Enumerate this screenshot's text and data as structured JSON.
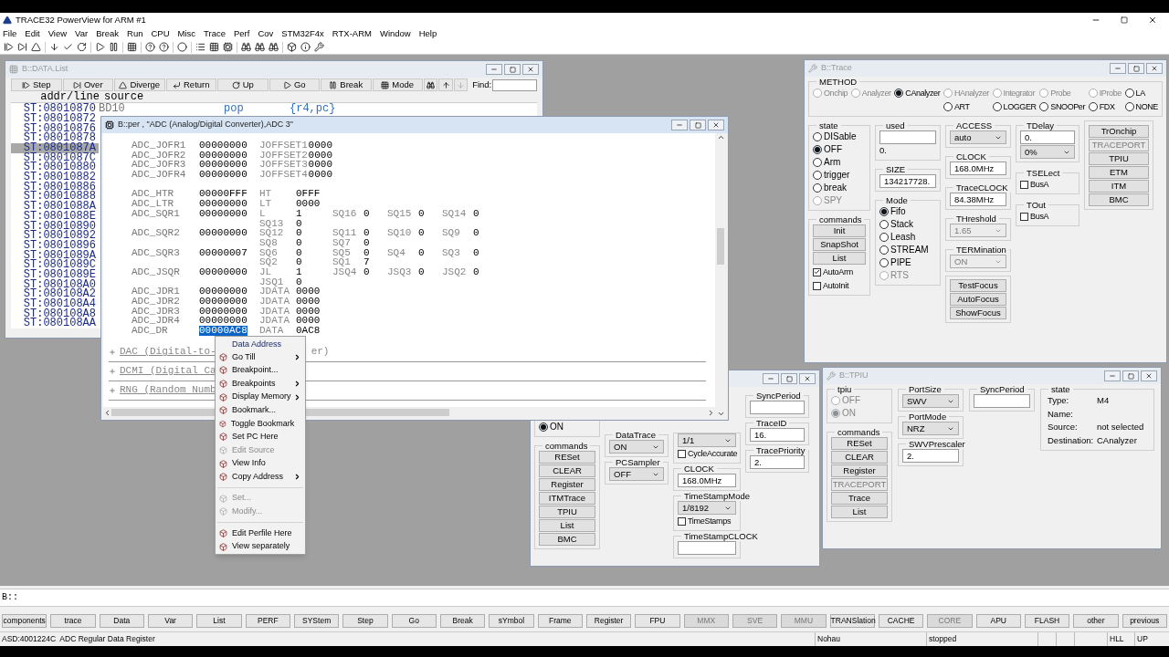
{
  "window": {
    "title": "TRACE32 PowerView for ARM #1"
  },
  "menu": [
    "File",
    "Edit",
    "View",
    "Var",
    "Break",
    "Run",
    "CPU",
    "Misc",
    "Trace",
    "Perf",
    "Cov",
    "STM32F4x",
    "RTX-ARM",
    "Window",
    "Help"
  ],
  "data_list": {
    "title": "B::DATA.List",
    "active": false,
    "buttons": [
      "Step",
      "Over",
      "Diverge",
      "Return",
      "Up",
      "Go",
      "Break",
      "Mode"
    ],
    "find_label": "Find:",
    "columns": [
      "addr/line",
      "source"
    ],
    "first_source": {
      "label": "BD10",
      "mnemonic": "pop",
      "operands": "{r4,pc}"
    },
    "rows": [
      {
        "address": "ST:08010870",
        "selected": false
      },
      {
        "address": "ST:08010872",
        "selected": false
      },
      {
        "address": "ST:08010876",
        "selected": false
      },
      {
        "address": "ST:08010878",
        "selected": false
      },
      {
        "address": "ST:0801087A",
        "selected": true
      },
      {
        "address": "ST:0801087C",
        "selected": false
      },
      {
        "address": "ST:08010880",
        "selected": false
      },
      {
        "address": "ST:08010882",
        "selected": false
      },
      {
        "address": "ST:08010886",
        "selected": false
      },
      {
        "address": "ST:08010888",
        "selected": false
      },
      {
        "address": "ST:0801088A",
        "selected": false
      },
      {
        "address": "ST:0801088E",
        "selected": false
      },
      {
        "address": "ST:08010890",
        "selected": false
      },
      {
        "address": "ST:08010892",
        "selected": false
      },
      {
        "address": "ST:08010896",
        "selected": false
      },
      {
        "address": "ST:0801089A",
        "selected": false
      },
      {
        "address": "ST:0801089C",
        "selected": false
      },
      {
        "address": "ST:0801089E",
        "selected": false
      },
      {
        "address": "ST:080108A0",
        "selected": false
      },
      {
        "address": "ST:080108A2",
        "selected": false
      },
      {
        "address": "ST:080108A4",
        "selected": false
      },
      {
        "address": "ST:080108A8",
        "selected": false
      },
      {
        "address": "ST:080108AA",
        "selected": false
      }
    ]
  },
  "peripheral": {
    "title": "B::per , \"ADC (Analog/Digital Converter),ADC 3\"",
    "active": true,
    "register_groups": [
      [
        {
          "name": "ADC_JOFR1",
          "value": "00000000",
          "selected": false,
          "fields": [
            {
              "label": "JOFFSET1",
              "value": "0000"
            }
          ]
        },
        {
          "name": "ADC_JOFR2",
          "value": "00000000",
          "selected": false,
          "fields": [
            {
              "label": "JOFFSET2",
              "value": "0000"
            }
          ]
        },
        {
          "name": "ADC_JOFR3",
          "value": "00000000",
          "selected": false,
          "fields": [
            {
              "label": "JOFFSET3",
              "value": "0000"
            }
          ]
        },
        {
          "name": "ADC_JOFR4",
          "value": "00000000",
          "selected": false,
          "fields": [
            {
              "label": "JOFFSET4",
              "value": "0000"
            }
          ]
        }
      ],
      [
        {
          "name": "ADC_HTR",
          "value": "00000FFF",
          "selected": false,
          "fields": [
            {
              "label": "HT",
              "value": "0FFF"
            }
          ]
        },
        {
          "name": "ADC_LTR",
          "value": "00000000",
          "selected": false,
          "fields": [
            {
              "label": "LT",
              "value": "0000"
            }
          ]
        },
        {
          "name": "ADC_SQR1",
          "value": "00000000",
          "selected": false,
          "fields": [
            {
              "label": "L",
              "value": "1"
            },
            {
              "label": "SQ16",
              "value": "0"
            },
            {
              "label": "SQ15",
              "value": "0"
            },
            {
              "label": "SQ14",
              "value": "0"
            }
          ]
        },
        {
          "fields": [
            {
              "label": "SQ13",
              "value": "0"
            }
          ]
        },
        {
          "name": "ADC_SQR2",
          "value": "00000000",
          "selected": false,
          "fields": [
            {
              "label": "SQ12",
              "value": "0"
            },
            {
              "label": "SQ11",
              "value": "0"
            },
            {
              "label": "SQ10",
              "value": "0"
            },
            {
              "label": "SQ9",
              "value": "0"
            }
          ]
        },
        {
          "fields": [
            {
              "label": "SQ8",
              "value": "0"
            },
            {
              "label": "SQ7",
              "value": "0"
            }
          ]
        },
        {
          "name": "ADC_SQR3",
          "value": "00000007",
          "selected": false,
          "fields": [
            {
              "label": "SQ6",
              "value": "0"
            },
            {
              "label": "SQ5",
              "value": "0"
            },
            {
              "label": "SQ4",
              "value": "0"
            },
            {
              "label": "SQ3",
              "value": "0"
            }
          ]
        },
        {
          "fields": [
            {
              "label": "SQ2",
              "value": "0"
            },
            {
              "label": "SQ1",
              "value": "7"
            }
          ]
        },
        {
          "name": "ADC_JSQR",
          "value": "00000000",
          "selected": false,
          "fields": [
            {
              "label": "JL",
              "value": "1"
            },
            {
              "label": "JSQ4",
              "value": "0"
            },
            {
              "label": "JSQ3",
              "value": "0"
            },
            {
              "label": "JSQ2",
              "value": "0"
            }
          ]
        },
        {
          "fields": [
            {
              "label": "JSQ1",
              "value": "0"
            }
          ]
        },
        {
          "name": "ADC_JDR1",
          "value": "00000000",
          "selected": false,
          "fields": [
            {
              "label": "JDATA",
              "value": "0000"
            }
          ]
        },
        {
          "name": "ADC_JDR2",
          "value": "00000000",
          "selected": false,
          "fields": [
            {
              "label": "JDATA",
              "value": "0000"
            }
          ]
        },
        {
          "name": "ADC_JDR3",
          "value": "00000000",
          "selected": false,
          "fields": [
            {
              "label": "JDATA",
              "value": "0000"
            }
          ]
        },
        {
          "name": "ADC_JDR4",
          "value": "00000000",
          "selected": false,
          "fields": [
            {
              "label": "JDATA",
              "value": "0000"
            }
          ]
        },
        {
          "name": "ADC_DR",
          "value": "00000AC8",
          "selected": true,
          "fields": [
            {
              "label": "DATA",
              "value": "0AC8"
            }
          ]
        }
      ]
    ],
    "sections": [
      {
        "text": "DAC (Digital-to-",
        "tail": "er)"
      },
      {
        "text": "DCMI (Digital Ca"
      },
      {
        "text": "RNG (Random Numb"
      }
    ]
  },
  "context_menu": [
    {
      "kind": "header",
      "label": "Data Address",
      "disabled": false
    },
    {
      "kind": "item",
      "label": "Go Till",
      "disabled": false,
      "submenu": true
    },
    {
      "kind": "item",
      "label": "Breakpoint...",
      "disabled": false,
      "submenu": false
    },
    {
      "kind": "item",
      "label": "Breakpoints",
      "disabled": false,
      "submenu": true
    },
    {
      "kind": "item",
      "label": "Display Memory",
      "disabled": false,
      "submenu": true
    },
    {
      "kind": "item",
      "label": "Bookmark...",
      "disabled": false,
      "submenu": false
    },
    {
      "kind": "item",
      "label": "Toggle Bookmark",
      "disabled": false,
      "submenu": false
    },
    {
      "kind": "item",
      "label": "Set PC Here",
      "disabled": false,
      "submenu": false
    },
    {
      "kind": "item",
      "label": "Edit Source",
      "disabled": true,
      "submenu": false
    },
    {
      "kind": "item",
      "label": "View Info",
      "disabled": false,
      "submenu": false
    },
    {
      "kind": "item",
      "label": "Copy Address",
      "disabled": false,
      "submenu": true
    },
    {
      "kind": "separator"
    },
    {
      "kind": "item",
      "label": "Set...",
      "disabled": true,
      "submenu": false
    },
    {
      "kind": "item",
      "label": "Modify...",
      "disabled": true,
      "submenu": false
    },
    {
      "kind": "separator"
    },
    {
      "kind": "item",
      "label": "Edit Perfile Here",
      "disabled": false,
      "submenu": false
    },
    {
      "kind": "item",
      "label": "View separately",
      "disabled": false,
      "submenu": false
    }
  ],
  "trace": {
    "title": "B::Trace",
    "active": false,
    "method": {
      "label": "METHOD",
      "row1": [
        {
          "label": "Onchip",
          "selected": false,
          "disabled": true
        },
        {
          "label": "Analyzer",
          "selected": false,
          "disabled": true
        },
        {
          "label": "CAnalyzer",
          "selected": true,
          "disabled": false
        },
        {
          "label": "HAnalyzer",
          "selected": false,
          "disabled": true
        },
        {
          "label": "Integrator",
          "selected": false,
          "disabled": true
        },
        {
          "label": "Probe",
          "selected": false,
          "disabled": true
        },
        {
          "label": "IProbe",
          "selected": false,
          "disabled": true
        },
        {
          "label": "LA",
          "selected": false,
          "disabled": false
        }
      ],
      "row2": [
        {
          "label": "ART",
          "selected": false,
          "disabled": false
        },
        {
          "label": "LOGGER",
          "selected": false,
          "disabled": false
        },
        {
          "label": "SNOOPer",
          "selected": false,
          "disabled": false
        },
        {
          "label": "FDX",
          "selected": false,
          "disabled": false
        },
        {
          "label": "NONE",
          "selected": false,
          "disabled": false
        }
      ]
    },
    "state": {
      "label": "state",
      "options": [
        {
          "label": "DISable",
          "selected": false,
          "disabled": false
        },
        {
          "label": "OFF",
          "selected": true,
          "disabled": false
        },
        {
          "label": "Arm",
          "selected": false,
          "disabled": false
        },
        {
          "label": "trigger",
          "selected": false,
          "disabled": false
        },
        {
          "label": "break",
          "selected": false,
          "disabled": false
        },
        {
          "label": "SPY",
          "selected": false,
          "disabled": true
        }
      ]
    },
    "commands": {
      "label": "commands",
      "buttons": [
        {
          "label": "Init",
          "disabled": false
        },
        {
          "label": "SnapShot",
          "disabled": false
        },
        {
          "label": "List",
          "disabled": false
        }
      ],
      "checks": [
        {
          "label": "AutoArm",
          "checked": true
        },
        {
          "label": "AutoInit",
          "checked": false
        }
      ]
    },
    "used": {
      "label": "used",
      "value": "0."
    },
    "size": {
      "label": "SIZE",
      "value": "134217728."
    },
    "mode": {
      "label": "Mode",
      "options": [
        {
          "label": "Fifo",
          "selected": true,
          "disabled": false
        },
        {
          "label": "Stack",
          "selected": false,
          "disabled": false
        },
        {
          "label": "Leash",
          "selected": false,
          "disabled": false
        },
        {
          "label": "STREAM",
          "selected": false,
          "disabled": false
        },
        {
          "label": "PIPE",
          "selected": false,
          "disabled": false
        },
        {
          "label": "RTS",
          "selected": false,
          "disabled": true
        }
      ]
    },
    "access": {
      "label": "ACCESS",
      "value": "auto",
      "disabled": false
    },
    "clock": {
      "label": "CLOCK",
      "value": "168.0MHz"
    },
    "traceclock": {
      "label": "TraceCLOCK",
      "value": "84.38MHz"
    },
    "threshold": {
      "label": "THreshold",
      "value": "1.65",
      "disabled": true
    },
    "termination": {
      "label": "TERMination",
      "value": "ON",
      "disabled": true
    },
    "focus_buttons": [
      {
        "label": "TestFocus",
        "disabled": false
      },
      {
        "label": "AutoFocus",
        "disabled": false
      },
      {
        "label": "ShowFocus",
        "disabled": false
      }
    ],
    "tdelay": {
      "label": "TDelay",
      "value": "0.",
      "percent": "0%",
      "disabled": false
    },
    "tselect": {
      "label": "TSELect",
      "check": {
        "label": "BusA",
        "checked": false
      }
    },
    "tout": {
      "label": "TOut",
      "check": {
        "label": "BusA",
        "checked": false
      }
    },
    "side_buttons": [
      {
        "label": "TrOnchip",
        "disabled": false
      },
      {
        "label": "TRACEPORT",
        "disabled": true
      },
      {
        "label": "TPIU",
        "disabled": false
      },
      {
        "label": "ETM",
        "disabled": false
      },
      {
        "label": "ITM",
        "disabled": false
      },
      {
        "label": "BMC",
        "disabled": false
      }
    ]
  },
  "itm": {
    "on_radio": {
      "label": "ON",
      "selected": true,
      "disabled": false
    },
    "commands": {
      "label": "commands",
      "buttons": [
        {
          "label": "RESet",
          "disabled": false
        },
        {
          "label": "CLEAR",
          "disabled": false
        },
        {
          "label": "Register",
          "disabled": false
        },
        {
          "label": "ITMTrace",
          "disabled": false
        },
        {
          "label": "TPIU",
          "disabled": false
        },
        {
          "label": "List",
          "disabled": false
        },
        {
          "label": "BMC",
          "disabled": false
        }
      ]
    },
    "datatrace": {
      "label": "DataTrace",
      "value": "ON",
      "disabled": false
    },
    "pcsampler": {
      "label": "PCSampler",
      "value": "OFF",
      "disabled": false
    },
    "cycle_combo": {
      "value": "1/1",
      "disabled": false
    },
    "cycleaccurate": {
      "label": "CycleAccurate",
      "checked": false
    },
    "clock": {
      "label": "CLOCK",
      "value": "168.0MHz"
    },
    "timestampmode": {
      "label": "TimeStampMode",
      "value": "1/8192",
      "disabled": false
    },
    "timestamps": {
      "label": "TimeStamps",
      "checked": false
    },
    "timestampclock": {
      "label": "TimeStampCLOCK"
    },
    "syncperiod": {
      "label": "SyncPeriod"
    },
    "traceid": {
      "label": "TraceID",
      "value": "16."
    },
    "tracepriority": {
      "label": "TracePriority",
      "value": "2."
    }
  },
  "tpiu": {
    "title": "B::TPIU",
    "active": false,
    "tpiu_group": {
      "label": "tpiu",
      "options": [
        {
          "label": "OFF",
          "selected": false,
          "disabled": true
        },
        {
          "label": "ON",
          "selected": true,
          "disabled": true
        }
      ]
    },
    "commands": {
      "label": "commands",
      "buttons": [
        {
          "label": "RESet",
          "disabled": false
        },
        {
          "label": "CLEAR",
          "disabled": false
        },
        {
          "label": "Register",
          "disabled": false
        },
        {
          "label": "TRACEPORT",
          "disabled": true
        },
        {
          "label": "Trace",
          "disabled": false
        },
        {
          "label": "List",
          "disabled": false
        }
      ]
    },
    "portsize": {
      "label": "PortSize",
      "value": "SWV",
      "disabled": false
    },
    "portmode": {
      "label": "PortMode",
      "value": "NRZ",
      "disabled": false
    },
    "prescaler": {
      "label": "SWVPrescaler",
      "value": "2."
    },
    "syncperiod": {
      "label": "SyncPeriod"
    },
    "state": {
      "label": "state",
      "rows": [
        {
          "label": "Type:",
          "value": "M4"
        },
        {
          "label": "Name:"
        },
        {
          "label": "Source:",
          "value": "not selected"
        },
        {
          "label": "Destination:",
          "value": "CAnalyzer"
        }
      ]
    }
  },
  "command_line": {
    "prompt": "B::"
  },
  "softkeys": [
    {
      "label": "components",
      "disabled": false
    },
    {
      "label": "trace",
      "disabled": false
    },
    {
      "label": "Data",
      "disabled": false
    },
    {
      "label": "Var",
      "disabled": false
    },
    {
      "label": "List",
      "disabled": false
    },
    {
      "label": "PERF",
      "disabled": false
    },
    {
      "label": "SYStem",
      "disabled": false
    },
    {
      "label": "Step",
      "disabled": false
    },
    {
      "label": "Go",
      "disabled": false
    },
    {
      "label": "Break",
      "disabled": false
    },
    {
      "label": "sYmbol",
      "disabled": false
    },
    {
      "label": "Frame",
      "disabled": false
    },
    {
      "label": "Register",
      "disabled": false
    },
    {
      "label": "FPU",
      "disabled": false
    },
    {
      "label": "MMX",
      "disabled": true
    },
    {
      "label": "SVE",
      "disabled": true
    },
    {
      "label": "MMU",
      "disabled": true
    },
    {
      "label": "TRANSlation",
      "disabled": false
    },
    {
      "label": "CACHE",
      "disabled": false
    },
    {
      "label": "CORE",
      "disabled": true
    },
    {
      "label": "APU",
      "disabled": false
    },
    {
      "label": "FLASH",
      "disabled": false
    },
    {
      "label": "other",
      "disabled": false
    },
    {
      "label": "previous",
      "disabled": false
    }
  ],
  "status_bar": {
    "message": "ASD:4001224C  ADC Regular Data Register",
    "source": "Nohau",
    "state": "stopped",
    "mode": "HLL",
    "direction": "UP"
  }
}
